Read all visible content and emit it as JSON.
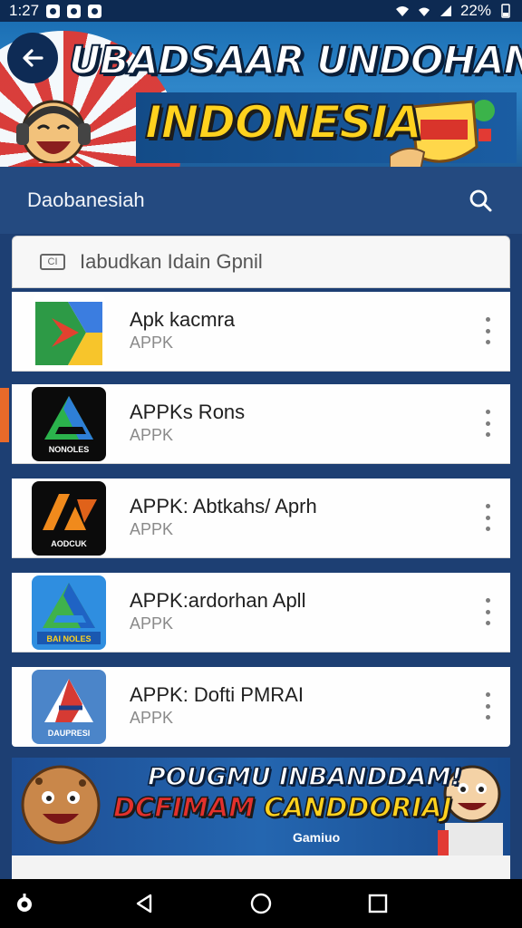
{
  "status_bar": {
    "time": "1:27",
    "battery": "22%"
  },
  "banner": {
    "line1": "UBADSAAR UNDOHAN",
    "line2": "INDONESIA"
  },
  "header": {
    "title": "Daobanesiah"
  },
  "search": {
    "tag": "CI",
    "placeholder": "Iabudkan Idain Gpnil"
  },
  "apps": [
    {
      "name": "Apk kacmra",
      "sub": "APPK",
      "icon": "google-drive-style-icon"
    },
    {
      "name": "APPKs Rons",
      "sub": "APPK",
      "icon": "green-a-icon",
      "icon_text": "NONOLES"
    },
    {
      "name": "APPK: Abtkahs/ Aprh",
      "sub": "APPK",
      "icon": "orange-a-icon",
      "icon_text": "AODCUK"
    },
    {
      "name": "APPK:ardorhan Apll",
      "sub": "APPK",
      "icon": "blue-a-icon",
      "icon_text": "BAI NOLES"
    },
    {
      "name": "APPK: Dofti PMRAI",
      "sub": "APPK",
      "icon": "red-blue-a-icon",
      "icon_text": "DAUPRESI"
    }
  ],
  "ad": {
    "line1": "POUGMU   INBANDDAM!",
    "line2_red": "DCFIMAM",
    "line2_yellow": "CANDDORIAJ",
    "small": "Gamiuo"
  },
  "colors": {
    "header_bg": "#244a80",
    "banner_yellow": "#ffd21e",
    "accent_orange": "#e86a2a"
  }
}
